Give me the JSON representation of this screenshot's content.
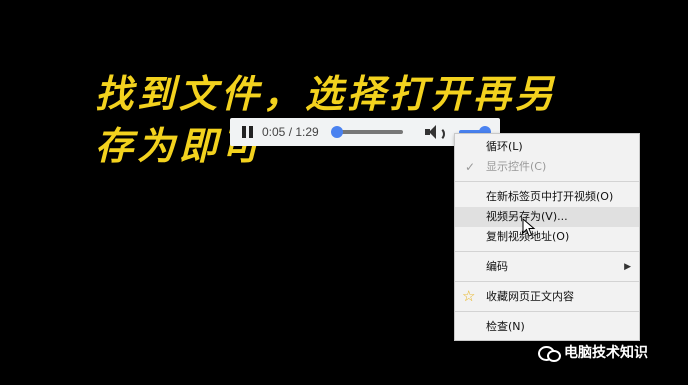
{
  "caption": {
    "line1": "找到文件，选择打开再另",
    "line2": "存为即可"
  },
  "player": {
    "time_display": "0:05 / 1:29",
    "progress_fraction": 0.06,
    "volume_fraction": 1.0,
    "accent_color": "#4a82f0"
  },
  "context_menu": {
    "loop": "循环(L)",
    "show_controls": "显示控件(C)",
    "open_in_new_tab": "在新标签页中打开视频(O)",
    "save_video_as": "视频另存为(V)...",
    "copy_video_address": "复制视频地址(O)",
    "encoding": "编码",
    "bookmark_content": "收藏网页正文内容",
    "inspect": "检查(N)",
    "icons": {
      "checkmark": "checkmark-icon",
      "star": "star-icon",
      "submenu": "chevron-right-icon"
    }
  },
  "watermark": {
    "text": "电脑技术知识"
  }
}
